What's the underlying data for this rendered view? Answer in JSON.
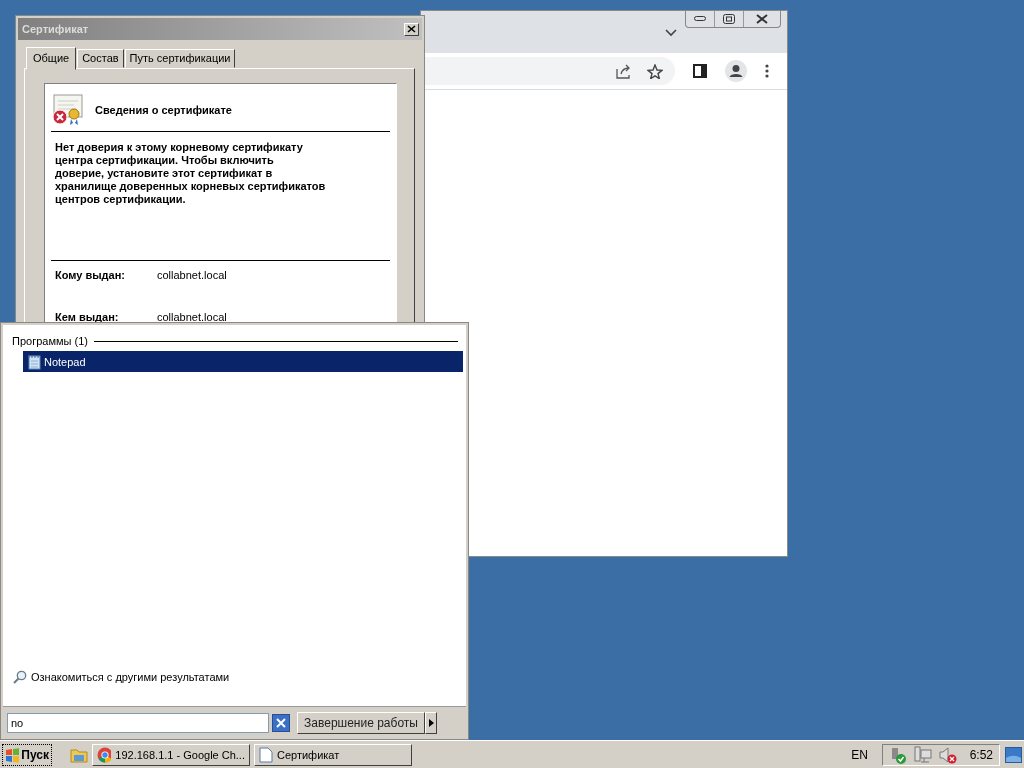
{
  "certificate_dialog": {
    "title": "Сертификат",
    "tabs": [
      {
        "label": "Общие",
        "selected": true
      },
      {
        "label": "Состав",
        "selected": false
      },
      {
        "label": "Путь сертификации",
        "selected": false
      }
    ],
    "heading": "Сведения о сертификате",
    "message": "Нет доверия к этому корневому сертификату центра сертификации. Чтобы включить  доверие, установите этот сертификат в хранилище доверенных корневых сертификатов центров сертификации.",
    "fields": [
      {
        "label": "Кому выдан:",
        "value": "collabnet.local"
      },
      {
        "label": "Кем выдан:",
        "value": "collabnet.local"
      }
    ]
  },
  "start_menu": {
    "section_title": "Программы (1)",
    "results": [
      {
        "label": "Notepad",
        "selected": true
      }
    ],
    "more_results": "Ознакомиться с другими результатами",
    "search": {
      "value": "no"
    },
    "shutdown": {
      "label": "Завершение работы"
    }
  },
  "taskbar": {
    "start": "Пуск",
    "tasks": [
      {
        "kind": "browser",
        "label": "192.168.1.1 - Google Ch..."
      },
      {
        "kind": "document",
        "label": "Сертификат"
      }
    ],
    "language": "EN",
    "clock": "6:52"
  }
}
